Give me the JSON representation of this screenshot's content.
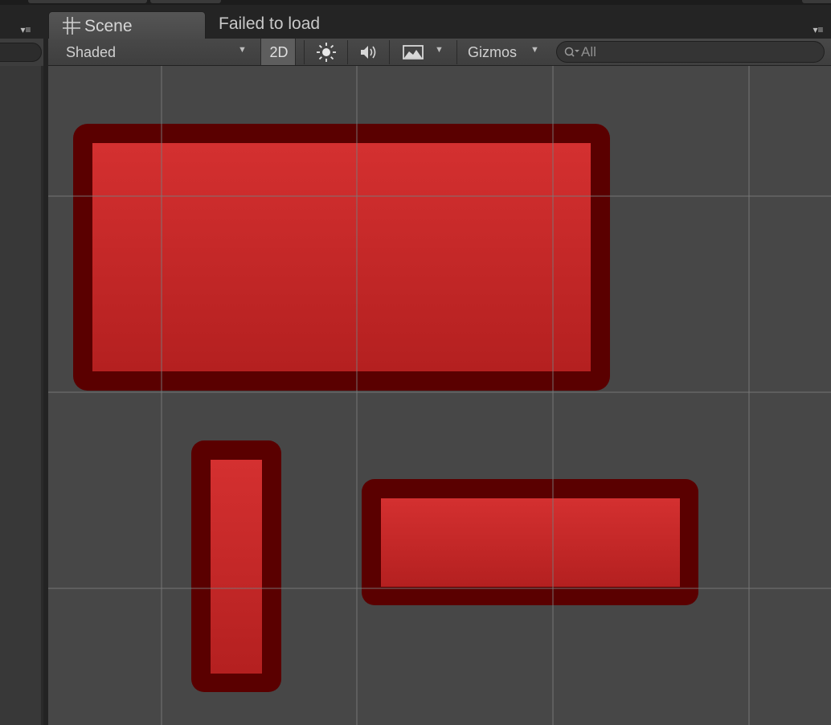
{
  "tabs": {
    "scene_label": "Scene",
    "failed_label": "Failed to load"
  },
  "toolbar": {
    "draw_mode": "Shaded",
    "mode_2d_label": "2D",
    "mode_2d_active": true,
    "gizmos_label": "Gizmos",
    "search_placeholder": "All"
  },
  "icons": {
    "scene_tab": "grid-hash-icon",
    "lighting": "sun-icon",
    "audio": "speaker-icon",
    "effects": "image-effects-icon",
    "search": "magnifier-dropdown-icon",
    "panel_menu": "context-menu-icon"
  },
  "colors": {
    "sprite_fill": "#cc2a28",
    "sprite_outline": "#5a0000",
    "viewport_bg": "#474747",
    "grid_line": "#5c5c5c"
  }
}
